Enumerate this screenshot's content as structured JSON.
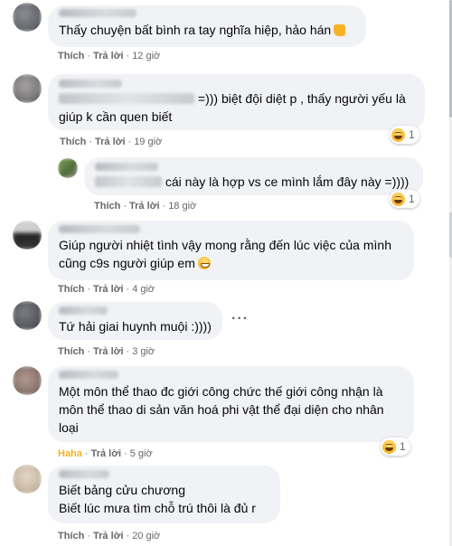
{
  "actions": {
    "like": "Thích",
    "reply": "Trả lời",
    "haha": "Haha"
  },
  "comments": [
    {
      "text": "Thấy chuyện bất bình ra tay nghĩa hiệp, hảo hán",
      "time": "12 giờ",
      "emoji": "thumbs-up"
    },
    {
      "text": "=))) biệt đội diệt p , thấy người yếu là giúp k cần quen biết",
      "time": "19 giờ",
      "reaction_count": "1"
    },
    {
      "text": "cái này là hợp vs ce mình lắm đây này =))))",
      "time": "18 giờ",
      "reaction_count": "1"
    },
    {
      "text": "Giúp người nhiệt tình vậy mong rằng đến lúc việc của mình cũng c9s người giúp em",
      "time": "4 giờ",
      "emoji": "grinning-face"
    },
    {
      "text": "Tứ hải giai huynh muội :))))",
      "time": "3 giờ"
    },
    {
      "text": "Một môn thể thao đc giới công chức thế giới công nhận là môn thể thao di sản văn hoá phi vật thể đại diện cho nhân loại",
      "time": "5 giờ",
      "reaction_count": "1"
    },
    {
      "text": "Biết bảng cửu chương\nBiết lúc mưa tìm chỗ trú thôi là đủ r",
      "time": "20 giờ"
    }
  ],
  "colors": {
    "bubble": "#f0f2f5",
    "meta": "#65676b",
    "haha": "#f7b125"
  }
}
